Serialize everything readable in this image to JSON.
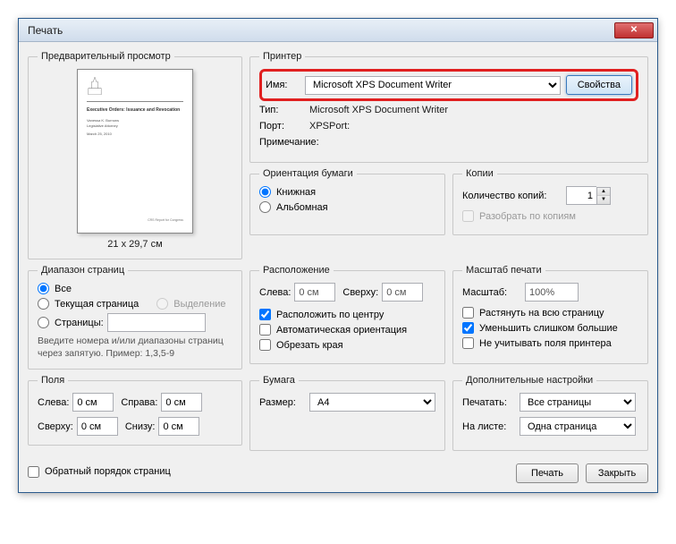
{
  "window": {
    "title": "Печать"
  },
  "preview": {
    "legend": "Предварительный просмотр",
    "dim": "21 x 29,7 см",
    "doc_title": "Executive Orders: Issuance and Revocation",
    "doc_author": "Vanessa K. Burrows",
    "doc_sub": "Legislative Attorney",
    "doc_date": "March 25, 2010",
    "doc_crs": "CRS Report for Congress"
  },
  "printer": {
    "legend": "Принтер",
    "name_label": "Имя:",
    "name_value": "Microsoft XPS Document Writer",
    "props_btn": "Свойства",
    "type_label": "Тип:",
    "type_value": "Microsoft XPS Document Writer",
    "port_label": "Порт:",
    "port_value": "XPSPort:",
    "note_label": "Примечание:"
  },
  "orient": {
    "legend": "Ориентация бумаги",
    "portrait": "Книжная",
    "landscape": "Альбомная"
  },
  "copies": {
    "legend": "Копии",
    "count_label": "Количество копий:",
    "count_value": "1",
    "collate": "Разобрать по копиям"
  },
  "range": {
    "legend": "Диапазон страниц",
    "all": "Все",
    "current": "Текущая страница",
    "selection": "Выделение",
    "pages": "Страницы:",
    "hint": "Введите номера и/или диапазоны страниц через запятую. Пример: 1,3,5-9"
  },
  "layout": {
    "legend": "Расположение",
    "left": "Слева:",
    "left_val": "0 см",
    "top": "Сверху:",
    "top_val": "0 см",
    "center": "Расположить по центру",
    "auto_orient": "Автоматическая ориентация",
    "crop": "Обрезать края"
  },
  "scale": {
    "legend": "Масштаб печати",
    "scale_label": "Масштаб:",
    "scale_val": "100%",
    "fit": "Растянуть на всю страницу",
    "shrink": "Уменьшить слишком большие",
    "ignore_margins": "Не учитывать поля принтера"
  },
  "margins": {
    "legend": "Поля",
    "left": "Слева:",
    "left_val": "0 см",
    "right": "Справа:",
    "right_val": "0 см",
    "top": "Сверху:",
    "top_val": "0 см",
    "bottom": "Снизу:",
    "bottom_val": "0 см"
  },
  "paper": {
    "legend": "Бумага",
    "size_label": "Размер:",
    "size_val": "A4"
  },
  "extra": {
    "legend": "Дополнительные настройки",
    "print_label": "Печатать:",
    "print_val": "Все страницы",
    "sheet_label": "На листе:",
    "sheet_val": "Одна страница"
  },
  "bottom": {
    "reverse": "Обратный порядок страниц",
    "print": "Печать",
    "close": "Закрыть"
  }
}
